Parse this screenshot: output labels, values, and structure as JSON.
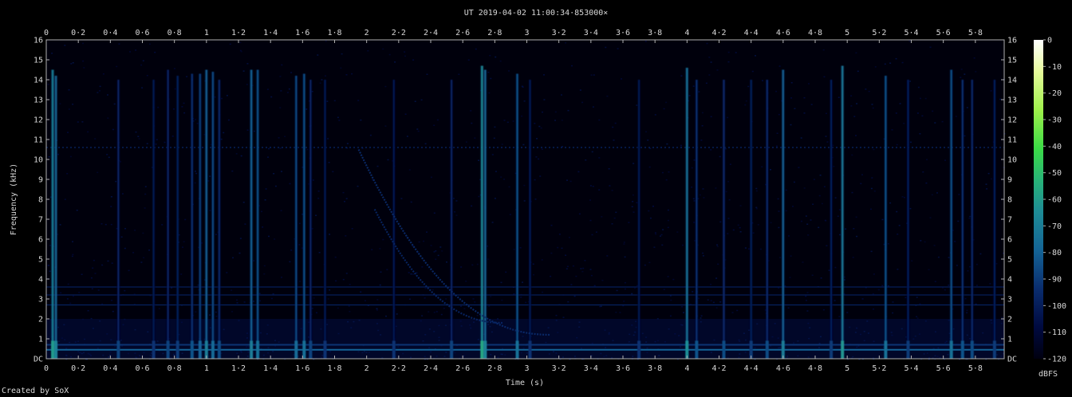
{
  "chart_data": {
    "type": "heatmap",
    "title": "UT 2019-04-02 11:00:34·853000×",
    "xlabel": "Time (s)",
    "ylabel": "Frequency (kHz)",
    "xlim": [
      0,
      5.98
    ],
    "ylim": [
      0,
      16
    ],
    "x_ticks": [
      "0",
      "0·2",
      "0·4",
      "0·6",
      "0·8",
      "1",
      "1·2",
      "1·4",
      "1·6",
      "1·8",
      "2",
      "2·2",
      "2·4",
      "2·6",
      "2·8",
      "3",
      "3·2",
      "3·4",
      "3·6",
      "3·8",
      "4",
      "4·2",
      "4·4",
      "4·6",
      "4·8",
      "5",
      "5·2",
      "5·4",
      "5·6",
      "5·8"
    ],
    "y_ticks": [
      "DC",
      "1",
      "2",
      "3",
      "4",
      "5",
      "6",
      "7",
      "8",
      "9",
      "10",
      "11",
      "12",
      "13",
      "14",
      "15",
      "16"
    ],
    "colorbar": {
      "label": "dBFS",
      "ticks": [
        "0",
        "-10",
        "-20",
        "-30",
        "-40",
        "-50",
        "-60",
        "-70",
        "-80",
        "-90",
        "-100",
        "-110",
        "-120"
      ],
      "range": [
        -120,
        0
      ],
      "colors": [
        "#000010",
        "#000a40",
        "#0a2d6e",
        "#146496",
        "#1e8c96",
        "#28b478",
        "#3cdc46",
        "#9ff04b",
        "#e6fa9b",
        "#ffffff"
      ]
    },
    "background_level_dbfs": -112,
    "broadband_events": [
      {
        "t": 0.04,
        "fmax_khz": 14.5,
        "level": -70
      },
      {
        "t": 0.06,
        "fmax_khz": 14.2,
        "level": -78
      },
      {
        "t": 0.45,
        "fmax_khz": 14.0,
        "level": -96
      },
      {
        "t": 0.67,
        "fmax_khz": 14.0,
        "level": -100
      },
      {
        "t": 0.76,
        "fmax_khz": 14.5,
        "level": -96
      },
      {
        "t": 0.82,
        "fmax_khz": 14.2,
        "level": -98
      },
      {
        "t": 0.91,
        "fmax_khz": 14.3,
        "level": -92
      },
      {
        "t": 0.96,
        "fmax_khz": 14.3,
        "level": -88
      },
      {
        "t": 1.0,
        "fmax_khz": 14.5,
        "level": -80
      },
      {
        "t": 1.04,
        "fmax_khz": 14.4,
        "level": -86
      },
      {
        "t": 1.08,
        "fmax_khz": 14.0,
        "level": -94
      },
      {
        "t": 1.28,
        "fmax_khz": 14.5,
        "level": -80
      },
      {
        "t": 1.32,
        "fmax_khz": 14.5,
        "level": -84
      },
      {
        "t": 1.56,
        "fmax_khz": 14.2,
        "level": -86
      },
      {
        "t": 1.61,
        "fmax_khz": 14.3,
        "level": -84
      },
      {
        "t": 1.65,
        "fmax_khz": 14.0,
        "level": -96
      },
      {
        "t": 1.74,
        "fmax_khz": 14.0,
        "level": -100
      },
      {
        "t": 2.17,
        "fmax_khz": 14.0,
        "level": -100
      },
      {
        "t": 2.53,
        "fmax_khz": 14.0,
        "level": -96
      },
      {
        "t": 2.72,
        "fmax_khz": 14.7,
        "level": -66
      },
      {
        "t": 2.74,
        "fmax_khz": 14.5,
        "level": -78
      },
      {
        "t": 2.94,
        "fmax_khz": 14.3,
        "level": -84
      },
      {
        "t": 3.02,
        "fmax_khz": 14.0,
        "level": -100
      },
      {
        "t": 3.7,
        "fmax_khz": 14.0,
        "level": -100
      },
      {
        "t": 4.0,
        "fmax_khz": 14.6,
        "level": -74
      },
      {
        "t": 4.06,
        "fmax_khz": 14.0,
        "level": -92
      },
      {
        "t": 4.23,
        "fmax_khz": 14.0,
        "level": -94
      },
      {
        "t": 4.4,
        "fmax_khz": 14.0,
        "level": -98
      },
      {
        "t": 4.5,
        "fmax_khz": 14.0,
        "level": -94
      },
      {
        "t": 4.6,
        "fmax_khz": 14.5,
        "level": -80
      },
      {
        "t": 4.9,
        "fmax_khz": 14.0,
        "level": -98
      },
      {
        "t": 4.97,
        "fmax_khz": 14.7,
        "level": -72
      },
      {
        "t": 5.24,
        "fmax_khz": 14.2,
        "level": -84
      },
      {
        "t": 5.38,
        "fmax_khz": 14.0,
        "level": -98
      },
      {
        "t": 5.65,
        "fmax_khz": 14.5,
        "level": -84
      },
      {
        "t": 5.72,
        "fmax_khz": 14.0,
        "level": -92
      },
      {
        "t": 5.78,
        "fmax_khz": 14.0,
        "level": -94
      },
      {
        "t": 5.92,
        "fmax_khz": 14.0,
        "level": -98
      }
    ],
    "tones_khz": [
      {
        "f": 0.45,
        "level": -80
      },
      {
        "f": 0.7,
        "level": -92
      },
      {
        "f": 2.7,
        "level": -98
      },
      {
        "f": 3.2,
        "level": -100
      },
      {
        "f": 3.6,
        "level": -100
      },
      {
        "f": 10.6,
        "level": -96
      }
    ],
    "whistlers": [
      {
        "t0": 1.95,
        "t1": 3.15,
        "f0_khz": 10.5,
        "f1_khz": 1.2,
        "level": -94
      },
      {
        "t0": 2.05,
        "t1": 2.85,
        "f0_khz": 7.5,
        "f1_khz": 1.8,
        "level": -96
      }
    ]
  },
  "credit": "Created by SoX"
}
